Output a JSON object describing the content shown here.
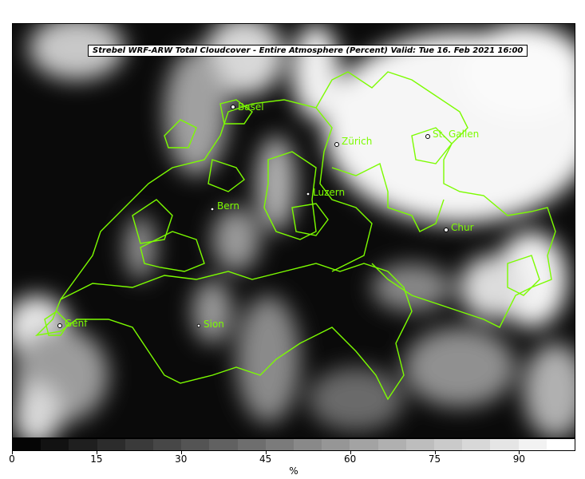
{
  "map": {
    "title": "Strebel WRF-ARW Total Cloudcover - Entire Atmosphere (Percent)   Valid: Tue 16. Feb 2021 16:00",
    "border_color": "#7CFC00",
    "cities": [
      {
        "name": "Basel"
      },
      {
        "name": "Zürich"
      },
      {
        "name": "St. Gallen"
      },
      {
        "name": "Luzern"
      },
      {
        "name": "Bern"
      },
      {
        "name": "Chur"
      },
      {
        "name": "Genf"
      },
      {
        "name": "Sion"
      }
    ]
  },
  "colorbar": {
    "unit": "%",
    "ticks": [
      "0",
      "15",
      "30",
      "45",
      "60",
      "75",
      "90"
    ],
    "tick_values": [
      0,
      15,
      30,
      45,
      60,
      75,
      90
    ],
    "min": 0,
    "max": 100,
    "step": 5
  }
}
